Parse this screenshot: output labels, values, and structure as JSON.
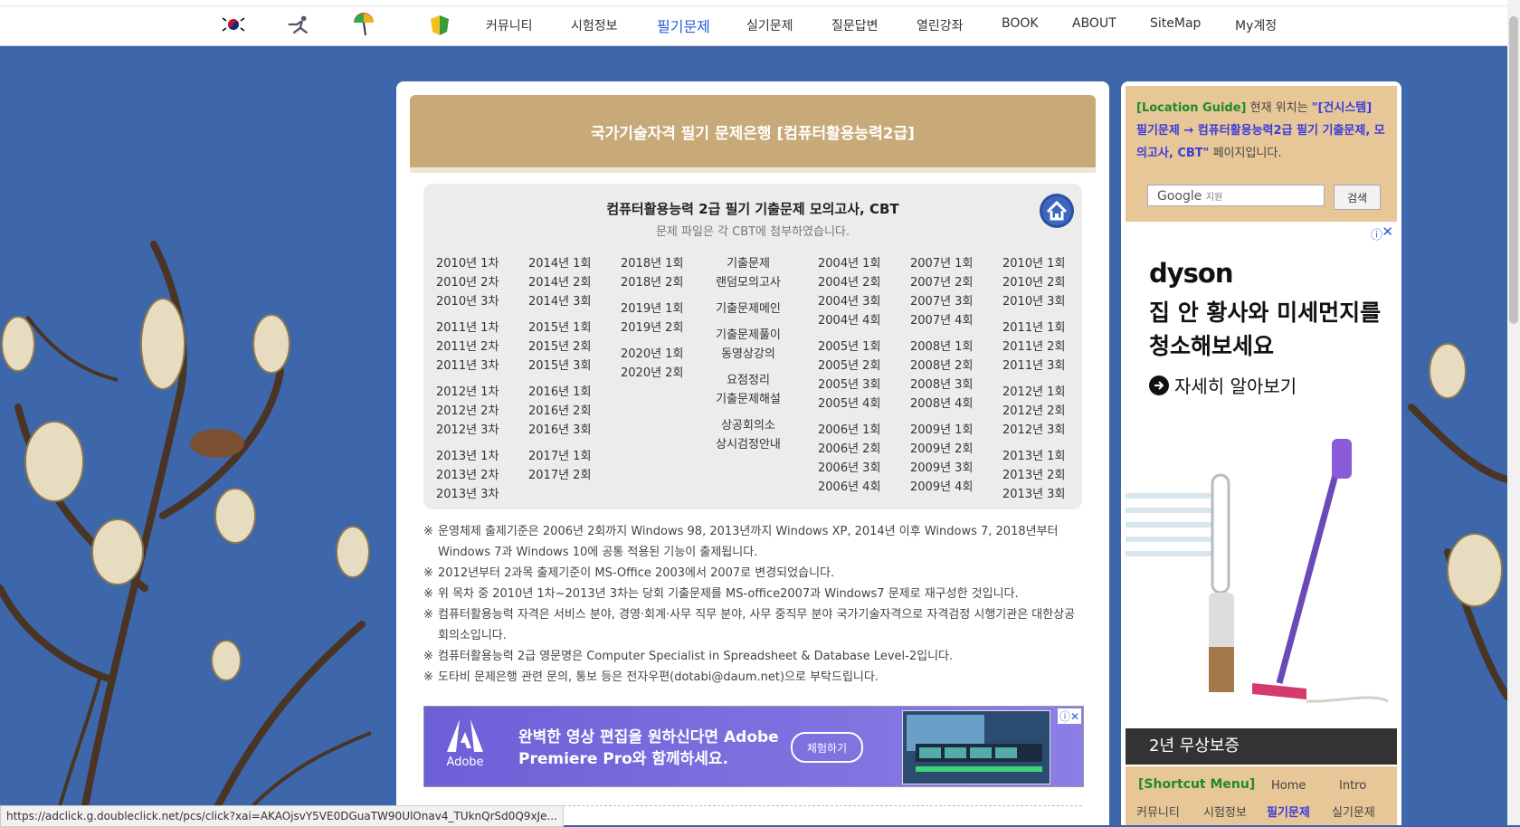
{
  "nav": {
    "icons": [
      "korea-flag-icon",
      "taekwondo-icon",
      "umbrella-icon",
      "flower-icon"
    ],
    "links": [
      "커뮤니티",
      "시험정보",
      "필기문제",
      "실기문제",
      "질문답변",
      "열린강좌",
      "BOOK",
      "ABOUT",
      "SiteMap",
      "My계정"
    ],
    "active": "필기문제"
  },
  "banner": {
    "title": "국가기술자격 필기 문제은행 [컴퓨터활용능력2급]"
  },
  "catalog": {
    "title": "컴퓨터활용능력 2급 필기 기출문제 모의고사, CBT",
    "subtitle": "문제 파일은 각 CBT에 첨부하였습니다.",
    "col1": [
      [
        "2010년 1차",
        "2010년 2차",
        "2010년 3차"
      ],
      [
        "2011년 1차",
        "2011년 2차",
        "2011년 3차"
      ],
      [
        "2012년 1차",
        "2012년 2차",
        "2012년 3차"
      ],
      [
        "2013년 1차",
        "2013년 2차",
        "2013년 3차"
      ]
    ],
    "col2": [
      [
        "2014년 1회",
        "2014년 2회",
        "2014년 3회"
      ],
      [
        "2015년 1회",
        "2015년 2회",
        "2015년 3회"
      ],
      [
        "2016년 1회",
        "2016년 2회",
        "2016년 3회"
      ],
      [
        "2017년 1회",
        "2017년 2회"
      ]
    ],
    "col3": [
      [
        "2018년 1회",
        "2018년 2회"
      ],
      [
        "2019년 1회",
        "2019년 2회"
      ],
      [
        "2020년 1회",
        "2020년 2회"
      ]
    ],
    "col4": [
      [
        "기출문제",
        "랜덤모의고사"
      ],
      [
        "기출문제메인"
      ],
      [
        "기출문제풀이",
        "동영상강의"
      ],
      [
        "요점정리",
        "기출문제해설"
      ],
      [
        "상공회의소",
        "상시검정안내"
      ]
    ],
    "col5": [
      [
        "2004년 1회",
        "2004년 2회",
        "2004년 3회",
        "2004년 4회"
      ],
      [
        "2005년 1회",
        "2005년 2회",
        "2005년 3회",
        "2005년 4회"
      ],
      [
        "2006년 1회",
        "2006년 2회",
        "2006년 3회",
        "2006년 4회"
      ]
    ],
    "col6": [
      [
        "2007년 1회",
        "2007년 2회",
        "2007년 3회",
        "2007년 4회"
      ],
      [
        "2008년 1회",
        "2008년 2회",
        "2008년 3회",
        "2008년 4회"
      ],
      [
        "2009년 1회",
        "2009년 2회",
        "2009년 3회",
        "2009년 4회"
      ]
    ],
    "col7": [
      [
        "2010년 1회",
        "2010년 2회",
        "2010년 3회"
      ],
      [
        "2011년 1회",
        "2011년 2회",
        "2011년 3회"
      ],
      [
        "2012년 1회",
        "2012년 2회",
        "2012년 3회"
      ],
      [
        "2013년 1회",
        "2013년 2회",
        "2013년 3회"
      ]
    ]
  },
  "notes": {
    "mark": "※",
    "items": [
      "운영체제 출제기준은 2006년 2회까지 Windows 98, 2013년까지 Windows XP, 2014년 이후 Windows 7, 2018년부터 Windows 7과 Windows 10에 공통 적용된 기능이 출제됩니다.",
      "2012년부터 2과목 출제기준이 MS-Office 2003에서 2007로 변경되었습니다.",
      "위 목차 중 2010년 1차~2013년 3차는 당회 기출문제를 MS-office2007과 Windows7 문제로 재구성한 것입니다.",
      "컴퓨터활용능력 자격은 서비스 분야, 경영·회계·사무 직무 분야, 사무 중직무 분야 국가기술자격으로 자격검정 시행기관은 대한상공회의소입니다.",
      "컴퓨터활용능력 2급 영문명은 Computer Specialist in Spreadsheet & Database Level-2입니다.",
      "도타비 문제은행 관련 문의, 통보 등은 전자우편(dotabi@daum.net)으로 부탁드립니다."
    ]
  },
  "adobe_ad": {
    "logo": "Adobe",
    "line1": "완벽한 영상 편집을 원하신다면 Adobe",
    "line2": "Premiere Pro와 함께하세요.",
    "button": "체험하기"
  },
  "sidebar": {
    "location_label": "[Location Guide]",
    "location_pre": "현재 위치는",
    "location_path": "\"[건시스템] 필기문제 → 컴퓨터활용능력2급 필기 기출문제, 모의고사, CBT\"",
    "location_post": "페이지입니다.",
    "search_brand": "Google",
    "search_suffix": "지원",
    "search_button": "검색"
  },
  "dyson_ad": {
    "brand": "dyson",
    "headline1": "집 안 황사와 미세먼지를",
    "headline2": "청소해보세요",
    "cta": "자세히 알아보기",
    "footer": "2년 무상보증"
  },
  "shortcut": {
    "title": "[Shortcut Menu]",
    "links": [
      "Home",
      "Intro",
      "커뮤니티",
      "시험정보",
      "필기문제",
      "실기문제"
    ],
    "active": "필기문제"
  },
  "status_url": "https://adclick.g.doubleclick.net/pcs/click?xai=AKAOjsvY5VE0DGuaTW90UlOnav4_TUknQrSd0Q9xJe...",
  "colors": {
    "banner": "#c8a978",
    "sidebar_tan": "#e7c798",
    "active_link": "#2a5bd7",
    "sky": "#3a63a8"
  }
}
